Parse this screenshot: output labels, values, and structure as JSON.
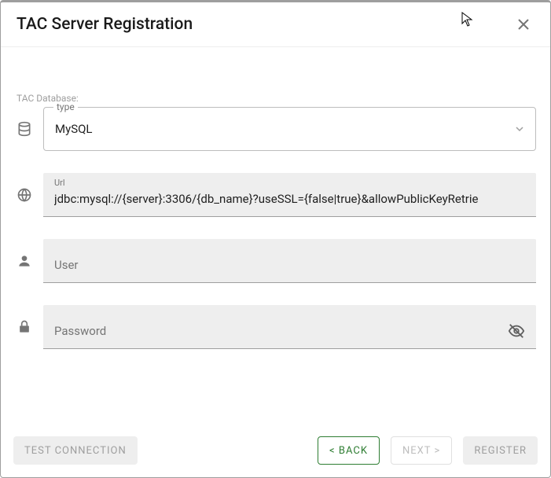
{
  "dialog": {
    "title": "TAC Server Registration",
    "section_label": "TAC Database:"
  },
  "db_type": {
    "label": "type",
    "value": "MySQL"
  },
  "url": {
    "label": "Url",
    "value": "jdbc:mysql://{server}:3306/{db_name}?useSSL={false|true}&allowPublicKeyRetrie"
  },
  "user": {
    "placeholder": "User",
    "value": ""
  },
  "password": {
    "placeholder": "Password",
    "value": ""
  },
  "buttons": {
    "test_connection": "TEST CONNECTION",
    "back": "< BACK",
    "next": "NEXT >",
    "register": "REGISTER"
  }
}
